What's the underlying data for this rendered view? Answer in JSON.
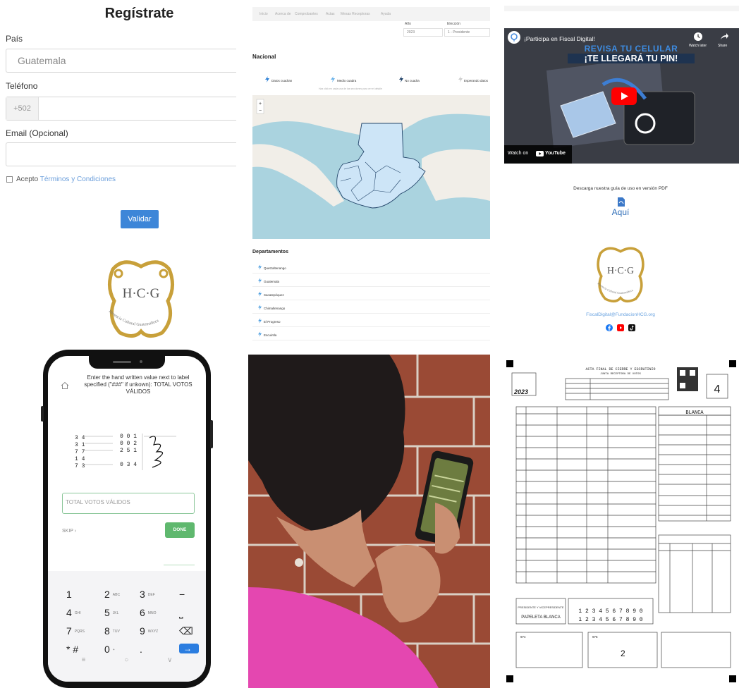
{
  "register": {
    "title": "Regístrate",
    "country_label": "País",
    "country_value": "Guatemala",
    "phone_label": "Teléfono",
    "phone_prefix": "+502",
    "email_label": "Email (Opcional)",
    "accept_text": "Acepto",
    "terms_link": "Términos y Condiciones",
    "validate_button": "Validar"
  },
  "logo": {
    "letters": "H·C·G",
    "ring_text": "Herencia Cultural Guatemalteca"
  },
  "results": {
    "nav_items": [
      "Inicio",
      "Acerca de",
      "Comprobantes",
      "Actas",
      "Mesas Receptoras",
      "Ayuda"
    ],
    "year_label": "Año",
    "year_value": "2023",
    "election_label": "Elección",
    "election_value": "1 - Presidente",
    "nacional_heading": "Nacional",
    "legend": [
      "Datos cuadran",
      "Medio cuadra",
      "No cuadra",
      "Esperando datos"
    ],
    "legend_note": "Haz click en cada una de las secciones para ver el detalle",
    "departamentos_heading": "Departamentos",
    "departments": [
      "Quetzaltenango",
      "Guatemala",
      "Sacatepéquez",
      "Chimaltenango",
      "El Progreso",
      "Escuintla"
    ]
  },
  "video": {
    "title": "¡Participa en Fiscal Digital!",
    "watch_later": "Watch later",
    "share": "Share",
    "overlay_line1": "REVISA TU CELULAR",
    "overlay_line2": "¡TE LLEGARÁ TU PIN!",
    "watch_on": "Watch on",
    "youtube": "YouTube"
  },
  "guide": {
    "caption": "Descarga nuestra guía de uso en versión PDF",
    "link": "Aquí",
    "email": "FiscalDigital@FundacionHCG.org"
  },
  "phone_app": {
    "instruction": "Enter the hand written value next to label specified (\"###\" if unkown): TOTAL VOTOS VÁLIDOS",
    "input_placeholder": "TOTAL VOTOS VÁLIDOS",
    "skip": "SKIP",
    "done": "DONE",
    "keys": [
      {
        "d": "1",
        "s": ""
      },
      {
        "d": "2",
        "s": "ABC"
      },
      {
        "d": "3",
        "s": "DEF"
      },
      {
        "d": "−",
        "s": ""
      },
      {
        "d": "4",
        "s": "GHI"
      },
      {
        "d": "5",
        "s": "JKL"
      },
      {
        "d": "6",
        "s": "MNO"
      },
      {
        "d": "⎵",
        "s": ""
      },
      {
        "d": "7",
        "s": "PQRS"
      },
      {
        "d": "8",
        "s": "TUV"
      },
      {
        "d": "9",
        "s": "WXYZ"
      },
      {
        "d": "⌫",
        "s": ""
      },
      {
        "d": "* #",
        "s": ""
      },
      {
        "d": "0",
        "s": "+"
      },
      {
        "d": ".",
        "s": ""
      },
      {
        "d": "→",
        "s": ""
      }
    ]
  },
  "ballot": {
    "header": "ACTA FINAL DE CIERRE Y ESCRUTINIO",
    "subheader": "JUNTA RECEPTORA DE VOTOS",
    "year": "2023",
    "number": "4",
    "blanca": "BLANCA",
    "papeleta": "PAPELETA BLANCA",
    "pres_label": "PRESIDENTE Y VICEPRESIDENTE",
    "digits": "1 2 3 4 5 6 7 8 9 0",
    "footer_a": "974",
    "footer_b": "975",
    "handwritten_two": "2"
  }
}
